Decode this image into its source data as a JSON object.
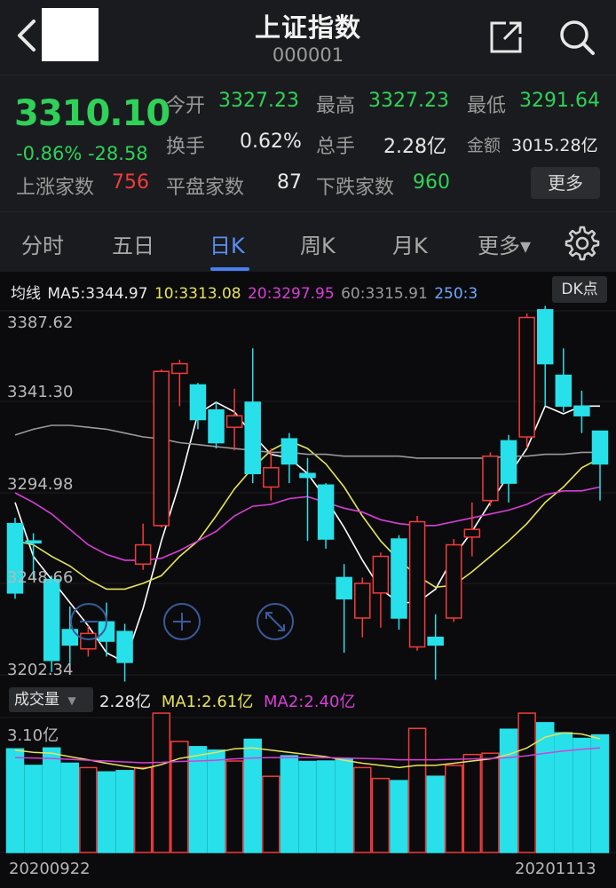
{
  "header": {
    "title": "上证指数",
    "code": "000001"
  },
  "quote": {
    "price": "3310.10",
    "change": "-0.86%  -28.58",
    "stats": [
      {
        "label": "今开",
        "value": "3327.23",
        "color": "green"
      },
      {
        "label": "最高",
        "value": "3327.23",
        "color": "green"
      },
      {
        "label": "最低",
        "value": "3291.64",
        "color": "green"
      },
      {
        "label": "换手",
        "value": "0.62%",
        "color": "white"
      },
      {
        "label": "总手",
        "value": "2.28亿",
        "color": "white"
      },
      {
        "label": "金额",
        "value": "3015.28亿",
        "color": "white"
      },
      {
        "label": "上涨家数",
        "value": "756",
        "color": "red"
      },
      {
        "label": "平盘家数",
        "value": "87",
        "color": "white"
      },
      {
        "label": "下跌家数",
        "value": "960",
        "color": "green"
      }
    ],
    "more_label": "更多"
  },
  "tabs": [
    {
      "label": "分时",
      "active": false
    },
    {
      "label": "五日",
      "active": false
    },
    {
      "label": "日K",
      "active": true
    },
    {
      "label": "周K",
      "active": false
    },
    {
      "label": "月K",
      "active": false
    },
    {
      "label": "更多▾",
      "active": false
    }
  ],
  "ma_legend": {
    "title": "均线",
    "ma5": "MA5:3344.97",
    "ma10": "10:3313.08",
    "ma20": "20:3297.95",
    "ma60": "60:3315.91",
    "ma250": "250:3",
    "dk_label": "DK点"
  },
  "volume_legend": {
    "select_label": "成交量",
    "vol": "2.28亿",
    "ma1": "MA1:2.61亿",
    "ma2": "MA2:2.40亿"
  },
  "colors": {
    "up": "#f23b3b",
    "down": "#27e0ea",
    "ma5": "#ffffff",
    "ma10": "#e6e35a",
    "ma20": "#d63fd6",
    "ma60": "#9a9a9a",
    "ma250": "#6fa8ff",
    "accent": "#4a7ff0",
    "price_green": "#2fd158"
  },
  "icons": [
    "back-icon",
    "share-icon",
    "search-icon",
    "gear-icon",
    "plus-icon",
    "expand-icon"
  ],
  "chart_data": {
    "type": "candlestick",
    "price_axis_labels": [
      "3387.62",
      "3341.30",
      "3294.98",
      "3248.66",
      "3202.34"
    ],
    "ylim": [
      3202.34,
      3387.62
    ],
    "volume_axis_label": "3.10亿",
    "volume_max": 3.1,
    "date_start": "20200922",
    "date_end": "20201113",
    "candles": [
      {
        "o": 3279,
        "c": 3243,
        "h": 3282,
        "l": 3240,
        "v": 2.38
      },
      {
        "o": 3270,
        "c": 3269,
        "h": 3274,
        "l": 3250,
        "v": 2.0
      },
      {
        "o": 3250,
        "c": 3208,
        "h": 3252,
        "l": 3202,
        "v": 2.4
      },
      {
        "o": 3224,
        "c": 3216,
        "h": 3236,
        "l": 3205,
        "v": 2.05
      },
      {
        "o": 3214,
        "c": 3222,
        "h": 3226,
        "l": 3210,
        "v": 1.95
      },
      {
        "o": 3228,
        "c": 3218,
        "h": 3238,
        "l": 3210,
        "v": 1.85
      },
      {
        "o": 3223,
        "c": 3207,
        "h": 3227,
        "l": 3197,
        "v": 1.88
      },
      {
        "o": 3258,
        "c": 3268,
        "h": 3279,
        "l": 3255,
        "v": 1.95
      },
      {
        "o": 3278,
        "c": 3358,
        "h": 3359,
        "l": 3277,
        "v": 3.2
      },
      {
        "o": 3357,
        "c": 3362,
        "h": 3364,
        "l": 3340,
        "v": 2.55
      },
      {
        "o": 3351,
        "c": 3333,
        "h": 3352,
        "l": 3328,
        "v": 2.43
      },
      {
        "o": 3338,
        "c": 3321,
        "h": 3342,
        "l": 3318,
        "v": 2.35
      },
      {
        "o": 3329,
        "c": 3335,
        "h": 3349,
        "l": 3317,
        "v": 2.1
      },
      {
        "o": 3342,
        "c": 3305,
        "h": 3370,
        "l": 3300,
        "v": 2.6
      },
      {
        "o": 3298,
        "c": 3308,
        "h": 3318,
        "l": 3291,
        "v": 1.75
      },
      {
        "o": 3323,
        "c": 3310,
        "h": 3326,
        "l": 3300,
        "v": 2.22
      },
      {
        "o": 3305,
        "c": 3303,
        "h": 3313,
        "l": 3270,
        "v": 2.09
      },
      {
        "o": 3299,
        "c": 3271,
        "h": 3300,
        "l": 3266,
        "v": 2.1
      },
      {
        "o": 3251,
        "c": 3240,
        "h": 3258,
        "l": 3212,
        "v": 2.15
      },
      {
        "o": 3230,
        "c": 3248,
        "h": 3251,
        "l": 3220,
        "v": 1.95
      },
      {
        "o": 3243,
        "c": 3262,
        "h": 3264,
        "l": 3225,
        "v": 1.7
      },
      {
        "o": 3271,
        "c": 3230,
        "h": 3273,
        "l": 3224,
        "v": 1.65
      },
      {
        "o": 3215,
        "c": 3280,
        "h": 3283,
        "l": 3213,
        "v": 2.85
      },
      {
        "o": 3220,
        "c": 3216,
        "h": 3232,
        "l": 3198,
        "v": 1.75
      },
      {
        "o": 3230,
        "c": 3268,
        "h": 3271,
        "l": 3228,
        "v": 2.0
      },
      {
        "o": 3272,
        "c": 3276,
        "h": 3290,
        "l": 3262,
        "v": 2.25
      },
      {
        "o": 3291,
        "c": 3314,
        "h": 3316,
        "l": 3288,
        "v": 2.28
      },
      {
        "o": 3322,
        "c": 3300,
        "h": 3325,
        "l": 3290,
        "v": 2.83
      },
      {
        "o": 3324,
        "c": 3386,
        "h": 3388,
        "l": 3318,
        "v": 3.2
      },
      {
        "o": 3390,
        "c": 3362,
        "h": 3392,
        "l": 3340,
        "v": 2.98
      },
      {
        "o": 3356,
        "c": 3340,
        "h": 3370,
        "l": 3337,
        "v": 2.75
      },
      {
        "o": 3340,
        "c": 3335,
        "h": 3348,
        "l": 3326,
        "v": 2.62
      },
      {
        "o": 3327,
        "c": 3310,
        "h": 3327,
        "l": 3291,
        "v": 2.7
      }
    ],
    "series": [
      {
        "name": "MA5",
        "values": [
          3290,
          3262,
          3250,
          3238,
          3226,
          3212,
          3207,
          3235,
          3270,
          3300,
          3336,
          3342,
          3337,
          3325,
          3315,
          3313,
          3305,
          3292,
          3277,
          3260,
          3245,
          3238,
          3238,
          3245,
          3262,
          3275,
          3290,
          3304,
          3318,
          3340,
          3336,
          3340,
          3340
        ]
      },
      {
        "name": "10",
        "values": [
          3270,
          3268,
          3262,
          3257,
          3250,
          3245,
          3245,
          3248,
          3252,
          3262,
          3270,
          3283,
          3297,
          3308,
          3317,
          3322,
          3318,
          3310,
          3298,
          3283,
          3270,
          3260,
          3252,
          3246,
          3247,
          3254,
          3262,
          3270,
          3279,
          3290,
          3298,
          3308,
          3313
        ]
      },
      {
        "name": "20",
        "values": [
          3295,
          3290,
          3284,
          3276,
          3268,
          3263,
          3260,
          3260,
          3261,
          3265,
          3270,
          3275,
          3283,
          3288,
          3289,
          3292,
          3293,
          3290,
          3287,
          3285,
          3281,
          3279,
          3278,
          3278,
          3280,
          3282,
          3284,
          3286,
          3289,
          3294,
          3296,
          3296,
          3298
        ]
      },
      {
        "name": "60",
        "values": [
          3325,
          3328,
          3330,
          3330,
          3329,
          3328,
          3326,
          3324,
          3323,
          3321,
          3320,
          3319,
          3318,
          3317,
          3316,
          3316,
          3315,
          3315,
          3314,
          3314,
          3314,
          3314,
          3313,
          3313,
          3313,
          3313,
          3313,
          3314,
          3314,
          3315,
          3315,
          3316,
          3316
        ]
      }
    ],
    "volume_ma": [
      {
        "name": "MA1",
        "values": [
          2.35,
          2.3,
          2.28,
          2.2,
          2.13,
          2.05,
          1.98,
          1.92,
          2.02,
          2.16,
          2.23,
          2.3,
          2.38,
          2.4,
          2.35,
          2.3,
          2.25,
          2.2,
          2.12,
          2.05,
          2.0,
          1.95,
          2.0,
          2.0,
          2.05,
          2.1,
          2.15,
          2.25,
          2.4,
          2.65,
          2.75,
          2.72,
          2.61
        ]
      },
      {
        "name": "MA2",
        "values": [
          2.18,
          2.17,
          2.16,
          2.14,
          2.12,
          2.1,
          2.08,
          2.06,
          2.07,
          2.09,
          2.1,
          2.12,
          2.15,
          2.17,
          2.18,
          2.18,
          2.18,
          2.18,
          2.17,
          2.16,
          2.15,
          2.13,
          2.13,
          2.13,
          2.14,
          2.15,
          2.16,
          2.18,
          2.22,
          2.28,
          2.33,
          2.37,
          2.4
        ]
      }
    ]
  }
}
